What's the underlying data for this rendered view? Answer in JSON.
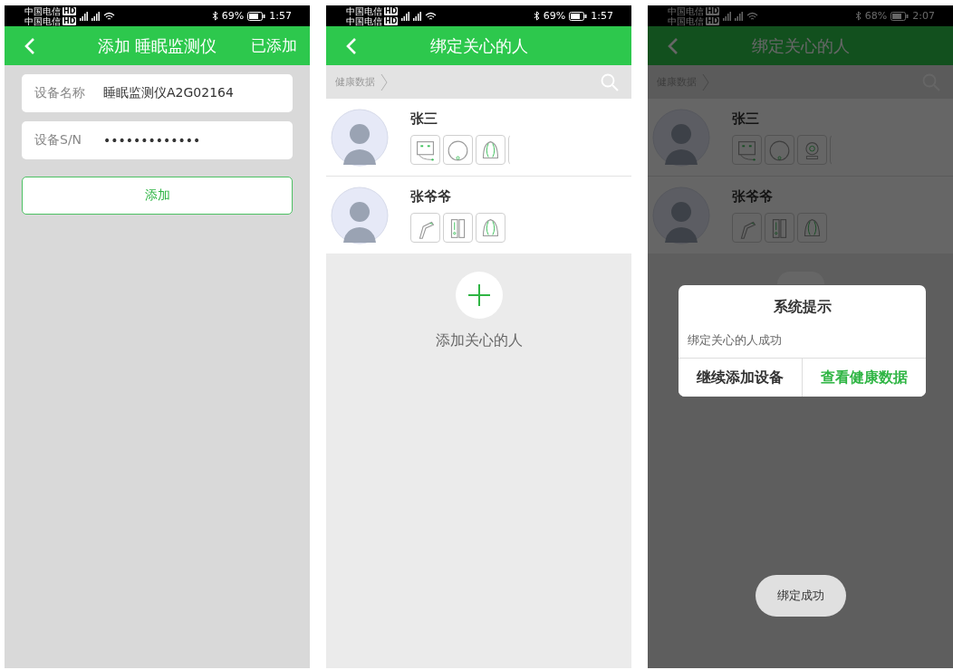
{
  "screens": [
    {
      "kind": "form",
      "dimmed": false,
      "status_bar": {
        "carriers": [
          {
            "name": "中国电信",
            "badge": "HD"
          },
          {
            "name": "中国电信",
            "badge": "HD"
          }
        ],
        "battery": "69%",
        "time": "1:57"
      },
      "nav": {
        "title": "添加 睡眠监测仪",
        "action": "已添加"
      },
      "fields": [
        {
          "label": "设备名称",
          "value": "睡眠监测仪A2G02164"
        },
        {
          "label": "设备S/N",
          "value": "•••••••••••••"
        }
      ],
      "button": "添加"
    },
    {
      "kind": "people",
      "dimmed": false,
      "status_bar": {
        "carriers": [
          {
            "name": "中国电信",
            "badge": "HD"
          },
          {
            "name": "中国电信",
            "badge": "HD"
          }
        ],
        "battery": "69%",
        "time": "1:57"
      },
      "nav": {
        "title": "绑定关心的人"
      },
      "breadcrumb": "健康数据",
      "people": [
        {
          "name": "张三",
          "devices": [
            {
              "kind": "sensor"
            },
            {
              "kind": "disc"
            },
            {
              "kind": "shell"
            },
            {
              "kind": "cut"
            }
          ]
        },
        {
          "name": "张爷爷",
          "devices": [
            {
              "kind": "thermometer"
            },
            {
              "kind": "door"
            },
            {
              "kind": "shell"
            }
          ]
        }
      ],
      "add_label": "添加关心的人"
    },
    {
      "kind": "people",
      "dimmed": true,
      "status_bar": {
        "carriers": [
          {
            "name": "中国电信",
            "badge": "HD"
          },
          {
            "name": "中国电信",
            "badge": "HD"
          }
        ],
        "battery": "68%",
        "time": "2:07"
      },
      "nav": {
        "title": "绑定关心的人"
      },
      "breadcrumb": "健康数据",
      "people": [
        {
          "name": "张三",
          "devices": [
            {
              "kind": "sensor"
            },
            {
              "kind": "disc"
            },
            {
              "kind": "camera"
            },
            {
              "kind": "cut"
            }
          ]
        },
        {
          "name": "张爷爷",
          "devices": [
            {
              "kind": "thermometer"
            },
            {
              "kind": "door"
            },
            {
              "kind": "shell"
            }
          ]
        }
      ],
      "dialog": {
        "title": "系统提示",
        "message": "绑定关心的人成功",
        "buttons": [
          {
            "label": "继续添加设备",
            "primary": false
          },
          {
            "label": "查看健康数据",
            "primary": true
          }
        ]
      },
      "toast": "绑定成功"
    }
  ]
}
